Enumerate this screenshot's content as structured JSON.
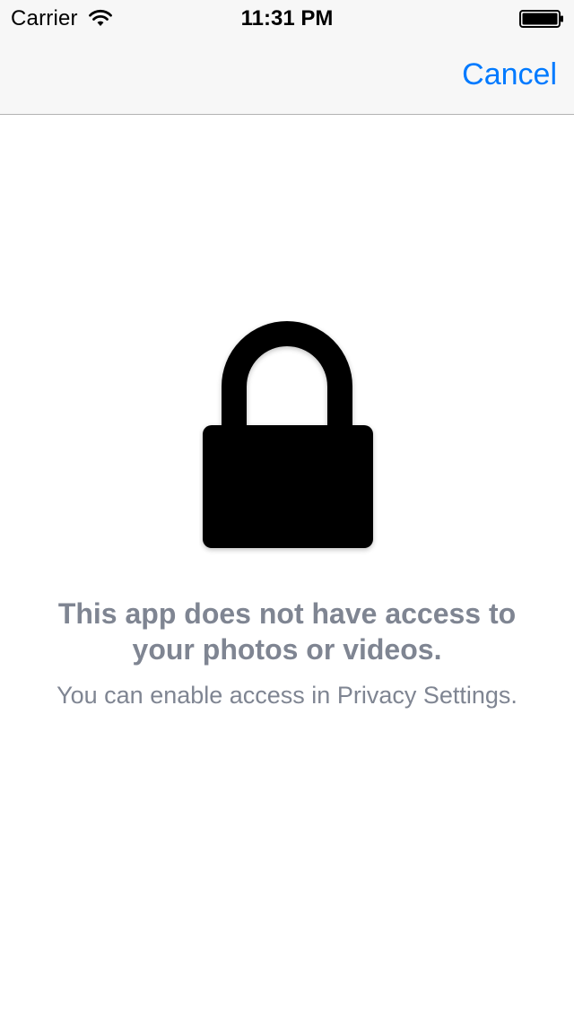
{
  "status_bar": {
    "carrier": "Carrier",
    "time": "11:31 PM",
    "wifi_icon": "wifi-icon",
    "battery_icon": "battery-full-icon"
  },
  "nav_bar": {
    "cancel_label": "Cancel"
  },
  "content": {
    "icon": "lock-icon",
    "title_line1": "This app does not have access to",
    "title_line2": "your photos or videos.",
    "subtitle": "You can enable access in Privacy Settings."
  },
  "colors": {
    "accent": "#007aff",
    "message_text": "#7f8592",
    "nav_background": "#f7f7f7"
  }
}
